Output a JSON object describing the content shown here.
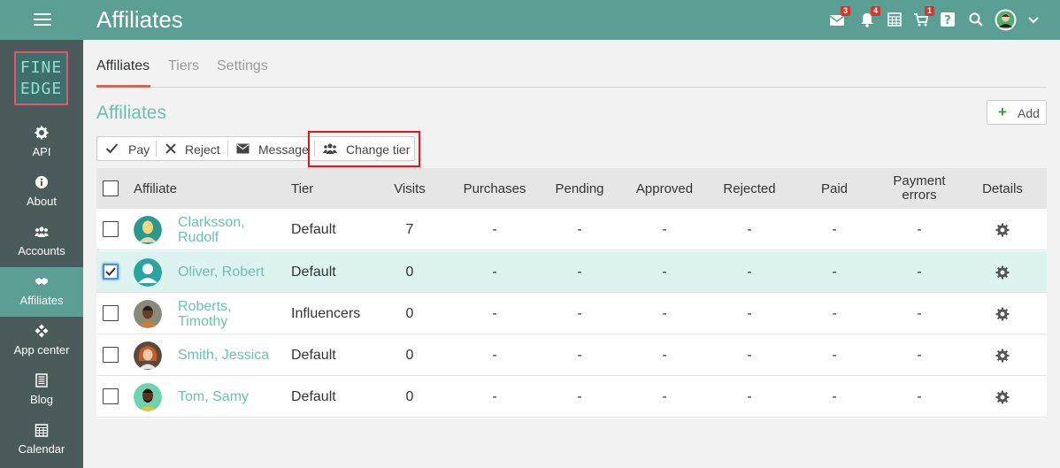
{
  "header": {
    "title": "Affiliates",
    "badges": {
      "mail": "3",
      "notifications": "4",
      "cart": "1"
    }
  },
  "logo": {
    "line1": "FINE",
    "line2": "EDGE"
  },
  "sidebar": {
    "items": [
      {
        "label": "API",
        "icon": "gear-icon"
      },
      {
        "label": "About",
        "icon": "info-icon"
      },
      {
        "label": "Accounts",
        "icon": "users-icon"
      },
      {
        "label": "Affiliates",
        "icon": "handshake-icon",
        "active": true
      },
      {
        "label": "App center",
        "icon": "apps-icon"
      },
      {
        "label": "Blog",
        "icon": "blog-icon"
      },
      {
        "label": "Calendar",
        "icon": "calendar-icon"
      }
    ]
  },
  "tabs": [
    {
      "label": "Affiliates",
      "active": true
    },
    {
      "label": "Tiers"
    },
    {
      "label": "Settings"
    }
  ],
  "section": {
    "title": "Affiliates",
    "add_label": "Add"
  },
  "toolbar": {
    "pay": "Pay",
    "reject": "Reject",
    "message": "Message",
    "change_tier": "Change tier"
  },
  "table": {
    "columns": {
      "affiliate": "Affiliate",
      "tier": "Tier",
      "visits": "Visits",
      "purchases": "Purchases",
      "pending": "Pending",
      "approved": "Approved",
      "rejected": "Rejected",
      "paid": "Paid",
      "payment_errors_1": "Payment",
      "payment_errors_2": "errors",
      "details": "Details"
    },
    "rows": [
      {
        "name1": "Clarksson,",
        "name2": "Rudolf",
        "tier": "Default",
        "visits": "7",
        "purchases": "-",
        "pending": "-",
        "approved": "-",
        "rejected": "-",
        "paid": "-",
        "errors": "-",
        "checked": false
      },
      {
        "name1": "Oliver, Robert",
        "name2": "",
        "tier": "Default",
        "visits": "0",
        "purchases": "-",
        "pending": "-",
        "approved": "-",
        "rejected": "-",
        "paid": "-",
        "errors": "-",
        "checked": true
      },
      {
        "name1": "Roberts,",
        "name2": "Timothy",
        "tier": "Influencers",
        "visits": "0",
        "purchases": "-",
        "pending": "-",
        "approved": "-",
        "rejected": "-",
        "paid": "-",
        "errors": "-",
        "checked": false
      },
      {
        "name1": "Smith, Jessica",
        "name2": "",
        "tier": "Default",
        "visits": "0",
        "purchases": "-",
        "pending": "-",
        "approved": "-",
        "rejected": "-",
        "paid": "-",
        "errors": "-",
        "checked": false
      },
      {
        "name1": "Tom, Samy",
        "name2": "",
        "tier": "Default",
        "visits": "0",
        "purchases": "-",
        "pending": "-",
        "approved": "-",
        "rejected": "-",
        "paid": "-",
        "errors": "-",
        "checked": false
      }
    ]
  },
  "colors": {
    "header_bg": "#5a9e94",
    "sidebar_bg": "#4b5a5a",
    "accent_teal": "#6cc0b2",
    "selected_row": "#ddf3f0",
    "highlight_red": "#e01818"
  }
}
